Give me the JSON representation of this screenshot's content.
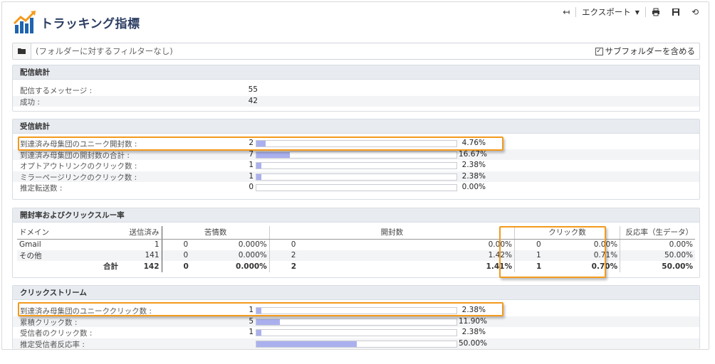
{
  "header": {
    "title": "トラッキング指標"
  },
  "toolbar": {
    "back_icon": "back-arrow-icon",
    "export_label": "エクスポート",
    "print_icon": "print-icon",
    "save_icon": "save-icon",
    "refresh_icon": "refresh-icon"
  },
  "filter": {
    "text": "(フォルダーに対するフィルターなし)",
    "subfolders_label": "サブフォルダーを含める",
    "subfolders_checked": true
  },
  "delivery": {
    "title": "配信統計",
    "rows": [
      {
        "label": "配信するメッセージ :",
        "value": "55"
      },
      {
        "label": "成功 :",
        "value": "42"
      }
    ]
  },
  "reception": {
    "title": "受信統計",
    "rows": [
      {
        "label": "到達済み母集団のユニーク開封数 :",
        "value": "2",
        "pct": "4.76%",
        "ratio": 0.0476
      },
      {
        "label": "到達済み母集団の開封数の合計 :",
        "value": "7",
        "pct": "16.67%",
        "ratio": 0.1667
      },
      {
        "label": "オプトアウトリンクのクリック数 :",
        "value": "1",
        "pct": "2.38%",
        "ratio": 0.0238
      },
      {
        "label": "ミラーページリンクのクリック数 :",
        "value": "1",
        "pct": "2.38%",
        "ratio": 0.0238
      },
      {
        "label": "推定転送数 :",
        "value": "0",
        "pct": "0.00%",
        "ratio": 0
      }
    ]
  },
  "opens": {
    "title": "開封率およびクリックスルー率",
    "headers": {
      "domain": "ドメイン",
      "sent": "送信済み",
      "complaints": "苦情数",
      "opens": "開封数",
      "clicks": "クリック数",
      "reactivity": "反応率（生データ）"
    },
    "rows": [
      {
        "domain": "Gmail",
        "sent": "1",
        "c_n": "0",
        "c_p": "0.000%",
        "o_n": "0",
        "o_p": "0.00%",
        "k_n": "0",
        "k_p": "0.00%",
        "react": "0.00%"
      },
      {
        "domain": "その他",
        "sent": "141",
        "c_n": "0",
        "c_p": "0.000%",
        "o_n": "2",
        "o_p": "1.42%",
        "k_n": "1",
        "k_p": "0.71%",
        "react": "50.00%"
      }
    ],
    "total": {
      "label": "合計",
      "sent": "142",
      "c_n": "0",
      "c_p": "0.000%",
      "o_n": "2",
      "o_p": "1.41%",
      "k_n": "1",
      "k_p": "0.70%",
      "react": "50.00%"
    }
  },
  "clickstream": {
    "title": "クリックストリーム",
    "rows": [
      {
        "label": "到達済み母集団のユニーククリック数 :",
        "value": "1",
        "pct": "2.38%",
        "ratio": 0.0238
      },
      {
        "label": "累積クリック数 :",
        "value": "5",
        "pct": "11.90%",
        "ratio": 0.119
      },
      {
        "label": "受信者のクリック数 :",
        "value": "1",
        "pct": "2.38%",
        "ratio": 0.0238
      },
      {
        "label": "推定受信者反応率 :",
        "value": "",
        "pct": "50.00%",
        "ratio": 0.5
      }
    ]
  },
  "colors": {
    "highlight": "#f39a1d",
    "bar_fill": "#aab0ee",
    "section_header": "#e8ecf1",
    "title": "#2c3e63"
  }
}
